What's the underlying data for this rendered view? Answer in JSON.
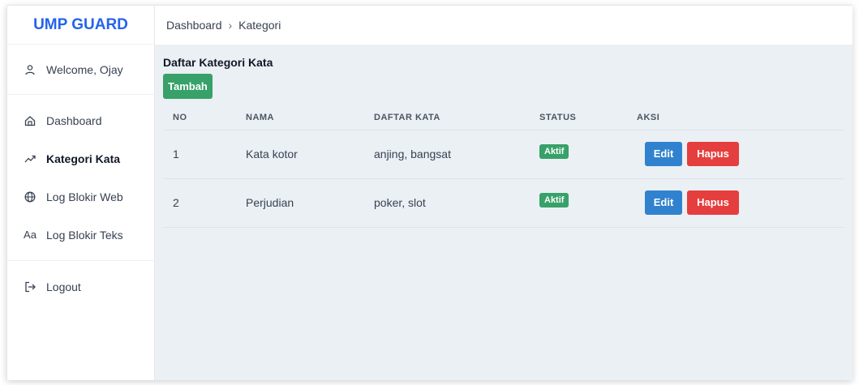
{
  "brand": "UMP GUARD",
  "welcome": "Welcome, Ojay",
  "nav": {
    "dashboard": "Dashboard",
    "kategori": "Kategori Kata",
    "log_web": "Log Blokir Web",
    "log_teks": "Log Blokir Teks",
    "logout": "Logout",
    "log_teks_icon_text": "Aa"
  },
  "breadcrumb": {
    "root": "Dashboard",
    "sep": "›",
    "current": "Kategori"
  },
  "page_title": "Daftar Kategori Kata",
  "add_button": "Tambah",
  "table": {
    "headers": [
      "NO",
      "NAMA",
      "DAFTAR KATA",
      "STATUS",
      "AKSI"
    ],
    "rows": [
      {
        "no": "1",
        "nama": "Kata kotor",
        "daftar": "anjing, bangsat",
        "status": "Aktif",
        "edit": "Edit",
        "hapus": "Hapus"
      },
      {
        "no": "2",
        "nama": "Perjudian",
        "daftar": "poker, slot",
        "status": "Aktif",
        "edit": "Edit",
        "hapus": "Hapus"
      }
    ]
  },
  "colors": {
    "brand": "#2563eb",
    "green": "#38a169",
    "blue": "#3182ce",
    "red": "#e53e3e",
    "content_bg": "#ebf0f5"
  },
  "icons": {
    "welcome": "user-icon",
    "dashboard": "home-icon",
    "kategori": "trend-icon",
    "log_web": "globe-icon",
    "log_teks": "text-icon",
    "logout": "logout-icon"
  }
}
